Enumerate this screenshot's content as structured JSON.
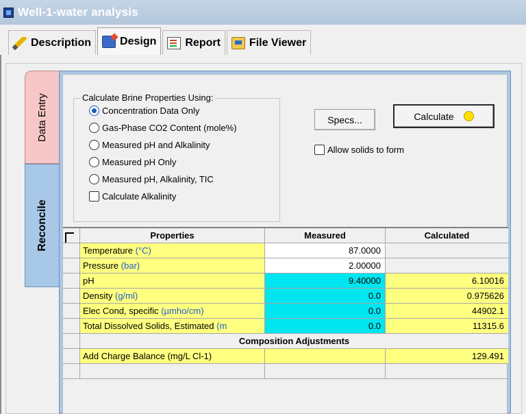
{
  "window": {
    "title": "Well-1-water analysis"
  },
  "tabs": [
    {
      "label": "Description",
      "icon": "pencil-icon"
    },
    {
      "label": "Design",
      "icon": "design-icon"
    },
    {
      "label": "Report",
      "icon": "report-icon"
    },
    {
      "label": "File Viewer",
      "icon": "folder-icon"
    }
  ],
  "side_tabs": {
    "data_entry": "Data Entry",
    "reconcile": "Reconcile"
  },
  "brine": {
    "legend": "Calculate Brine Properties Using:",
    "options": [
      "Concentration Data Only",
      "Gas-Phase CO2 Content (mole%)",
      "Measured pH and Alkalinity",
      "Measured pH Only",
      "Measured pH, Alkalinity, TIC"
    ],
    "selected": "Concentration Data Only",
    "calc_alkalinity": "Calculate Alkalinity"
  },
  "buttons": {
    "specs": "Specs...",
    "calculate": "Calculate"
  },
  "allow_solids": "Allow solids to form",
  "grid": {
    "headers": {
      "properties": "Properties",
      "measured": "Measured",
      "calculated": "Calculated"
    },
    "rows": [
      {
        "name": "Temperature",
        "unit": "(°C)",
        "measured": "87.0000",
        "calculated": ""
      },
      {
        "name": "Pressure",
        "unit": "(bar)",
        "measured": "2.00000",
        "calculated": ""
      },
      {
        "name": "pH",
        "unit": "",
        "measured": "9.40000",
        "calculated": "6.10016"
      },
      {
        "name": "Density",
        "unit": "(g/ml)",
        "measured": "0.0",
        "calculated": "0.975626"
      },
      {
        "name": "Elec Cond, specific",
        "unit": "(µmho/cm)",
        "measured": "0.0",
        "calculated": "44902.1"
      },
      {
        "name": "Total Dissolved Solids, Estimated",
        "unit": "(m",
        "measured": "0.0",
        "calculated": "11315.6"
      }
    ],
    "section_title": "Composition Adjustments",
    "adjust_row": {
      "name": "Add Charge Balance (mg/L Cl-1)",
      "measured": "",
      "calculated": "129.491"
    }
  },
  "colors": {
    "yellow": "#ffff80",
    "cyan": "#00e6f0",
    "tab_blue": "#a8c8e8",
    "tab_pink": "#f7c7c7",
    "unit_blue": "#1f5ec9"
  }
}
